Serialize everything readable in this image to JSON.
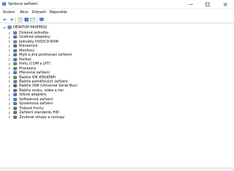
{
  "window": {
    "title": "Správce zařízení"
  },
  "menu": [
    "Soubor",
    "Akce",
    "Zobrazit",
    "Nápověda"
  ],
  "toolbar": {
    "icons": [
      "back-icon",
      "forward-icon",
      "properties-icon",
      "help-icon",
      "view-icon",
      "monitor-icon"
    ]
  },
  "tree": {
    "root": {
      "label": "DESKTOP-H60PMQ2",
      "icon": "computer-icon"
    },
    "items": [
      {
        "label": "Diskové jednotky",
        "icon": "disk-drive-icon",
        "color": "#6b7b8c"
      },
      {
        "label": "Grafické adaptéry",
        "icon": "display-adapter-icon",
        "color": "#3a7bd5"
      },
      {
        "label": "Jednotky DVD/CD-ROM",
        "icon": "dvd-drive-icon",
        "color": "#7d8a96"
      },
      {
        "label": "Klávesnice",
        "icon": "keyboard-icon",
        "color": "#6a6a6a"
      },
      {
        "label": "Monitory",
        "icon": "monitor-icon",
        "color": "#2f7fd6"
      },
      {
        "label": "Myši a jiná polohovací zařízení",
        "icon": "mouse-icon",
        "color": "#6a6a6a"
      },
      {
        "label": "Počítač",
        "icon": "computer-icon",
        "color": "#2f7fd6"
      },
      {
        "label": "Porty (COM a LPT)",
        "icon": "port-icon",
        "color": "#7a7a7a"
      },
      {
        "label": "Procesory",
        "icon": "processor-icon",
        "color": "#4a9a4a"
      },
      {
        "label": "Přenosná zařízení",
        "icon": "portable-device-icon",
        "color": "#2f7fd6"
      },
      {
        "label": "Řadiče IDE ATA/ATAPI",
        "icon": "ide-controller-icon",
        "color": "#4a9a4a"
      },
      {
        "label": "Řadiče paměťových zařízení",
        "icon": "storage-controller-icon",
        "color": "#6b7b8c"
      },
      {
        "label": "Řadiče USB (Universal Serial Bus)",
        "icon": "usb-controller-icon",
        "color": "#5a5a5a"
      },
      {
        "label": "Řadiče zvuku, videa a her",
        "icon": "sound-icon",
        "color": "#6a6a6a"
      },
      {
        "label": "Síťové adaptéry",
        "icon": "network-adapter-icon",
        "color": "#2f7fd6"
      },
      {
        "label": "Softwarová zařízení",
        "icon": "software-device-icon",
        "color": "#2f7fd6"
      },
      {
        "label": "Systémová zařízení",
        "icon": "system-device-icon",
        "color": "#2f7fd6"
      },
      {
        "label": "Tiskové fronty",
        "icon": "printer-icon",
        "color": "#6a6a6a"
      },
      {
        "label": "Zařízení standardu HID",
        "icon": "hid-icon",
        "color": "#6a6a6a"
      },
      {
        "label": "Zvukové vstupy a výstupy",
        "icon": "audio-io-icon",
        "color": "#6a6a6a"
      }
    ]
  }
}
